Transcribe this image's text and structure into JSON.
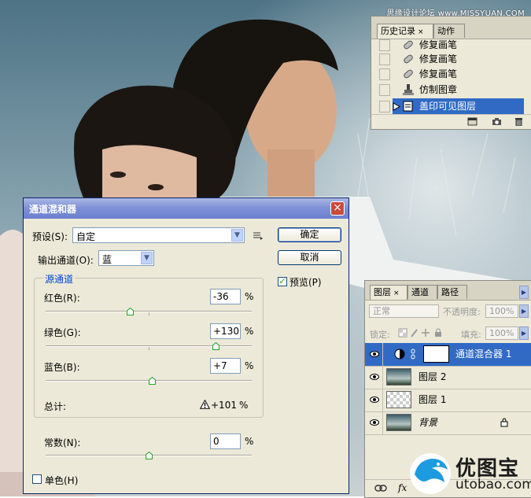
{
  "watermark": "思缘设计论坛 www.MISSYUAN.COM",
  "history_panel": {
    "tabs": [
      {
        "label": "历史记录",
        "close": "×"
      },
      {
        "label": "动作"
      }
    ],
    "items": [
      {
        "label": "修复画笔",
        "icon": "healing-brush-icon"
      },
      {
        "label": "修复画笔",
        "icon": "healing-brush-icon"
      },
      {
        "label": "修复画笔",
        "icon": "healing-brush-icon"
      },
      {
        "label": "仿制图章",
        "icon": "clone-stamp-icon"
      },
      {
        "label": "盖印可见图层",
        "icon": "layer-stamp-icon",
        "selected": true
      }
    ]
  },
  "channel_mixer": {
    "title": "通道混和器",
    "close": "×",
    "preset_label": "预设(S):",
    "preset_value": "自定",
    "output_label": "输出通道(O):",
    "output_value": "蓝",
    "ok_label": "确定",
    "cancel_label": "取消",
    "preview_label": "预览(P)",
    "preview_checked": true,
    "group_title": "源通道",
    "sources": [
      {
        "label": "红色(R):",
        "value": "-36",
        "unit": "%",
        "level": -36
      },
      {
        "label": "绿色(G):",
        "value": "+130",
        "unit": "%",
        "level": 130
      },
      {
        "label": "蓝色(B):",
        "value": "+7",
        "unit": "%",
        "level": 7
      }
    ],
    "total_label": "总计:",
    "total_value": "+101",
    "total_unit": "%",
    "constant_label": "常数(N):",
    "constant_value": "0",
    "constant_unit": "%",
    "constant_level": 0,
    "mono_label": "单色(H)",
    "mono_checked": false
  },
  "layers_panel": {
    "tabs": [
      {
        "label": "图层",
        "close": "×"
      },
      {
        "label": "通道"
      },
      {
        "label": "路径"
      }
    ],
    "blend_mode": "正常",
    "opacity_label": "不透明度:",
    "opacity_value": "100%",
    "lock_label": "锁定:",
    "fill_label": "填充:",
    "fill_value": "100%",
    "layers": [
      {
        "name": "通道混合器 1",
        "selected": true,
        "kind": "adjustment"
      },
      {
        "name": "图层 2",
        "kind": "photo"
      },
      {
        "name": "图层 1",
        "kind": "transparent"
      },
      {
        "name": "背景",
        "kind": "photo",
        "locked": true
      }
    ],
    "footer_icons": [
      "link-icon",
      "fx-icon"
    ]
  },
  "logo": {
    "text": "优图宝",
    "url": "utobao.com"
  },
  "colors": {
    "selection": "#316ac5",
    "dialog_bg": "#ece9d8",
    "title_bar": "#7d8fd6",
    "logo_blue": "#1d9be0"
  }
}
